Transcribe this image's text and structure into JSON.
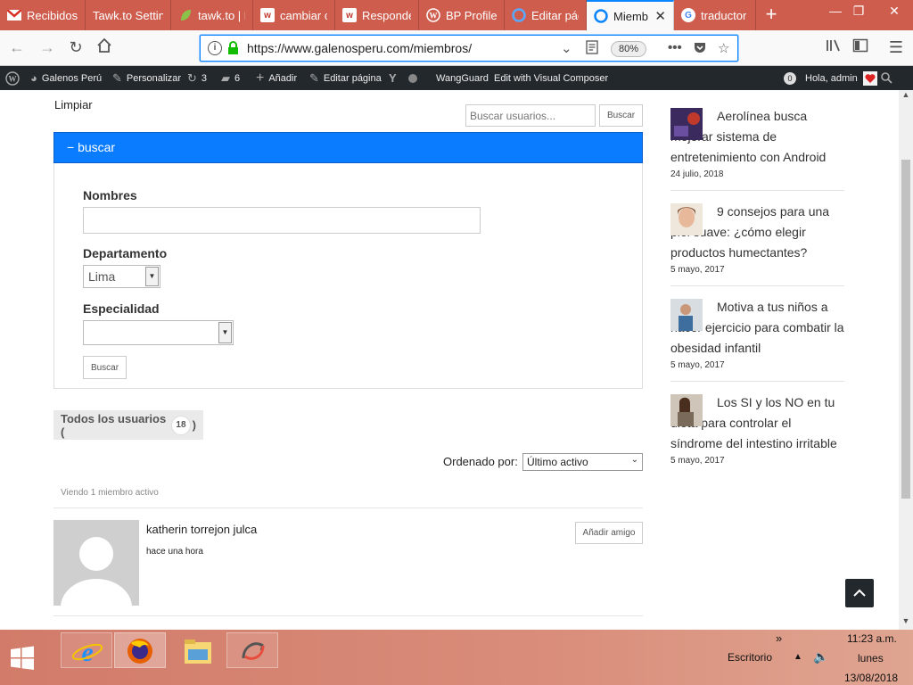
{
  "browser": {
    "tabs": [
      {
        "label": "Recibidos",
        "icon": "gmail-icon"
      },
      {
        "label": "Tawk.to Settin",
        "icon": "tawk-icon"
      },
      {
        "label": "tawk.to | F",
        "icon": "leaf-icon"
      },
      {
        "label": "cambiar c",
        "icon": "w-icon"
      },
      {
        "label": "Responde",
        "icon": "w-icon"
      },
      {
        "label": "BP Profile",
        "icon": "wordpress-icon"
      },
      {
        "label": "Editar pág",
        "icon": "wp-edit-icon"
      },
      {
        "label": "Miemb",
        "icon": "wp-edit-icon"
      },
      {
        "label": "traductor",
        "icon": "google-icon"
      }
    ],
    "url": "https://www.galenosperu.com/miembros/",
    "zoom": "80%"
  },
  "adminbar": {
    "site": "Galenos Perú",
    "customize": "Personalizar",
    "updates": "3",
    "comments": "6",
    "add": "Añadir",
    "edit_page": "Editar página",
    "wangguard": "WangGuard",
    "visual_composer": "Edit with Visual Composer",
    "notif_count": "0",
    "greeting": "Hola, admin"
  },
  "page": {
    "limpiar": "Limpiar",
    "search_placeholder": "Buscar usuarios...",
    "search_button": "Buscar",
    "panel_title": "− buscar",
    "form": {
      "nombres_label": "Nombres",
      "departamento_label": "Departamento",
      "departamento_value": "Lima",
      "especialidad_label": "Especialidad",
      "especialidad_value": "",
      "submit": "Buscar"
    },
    "all_users_prefix": "Todos los usuarios (",
    "all_users_count": "18",
    "all_users_suffix": ")",
    "order_label": "Ordenado por:",
    "order_value": "Último activo",
    "viewing": "Viendo 1 miembro activo",
    "member": {
      "name": "katherin torrejon julca",
      "last_active": "hace una hora",
      "add_friend": "Añadir amigo"
    }
  },
  "sidebar": {
    "posts": [
      {
        "title": "Aerolínea busca mejorar sistema de entretenimiento con Android",
        "date": "24 julio, 2018"
      },
      {
        "title": "9 consejos para una piel suave: ¿cómo elegir productos humectantes?",
        "date": "5 mayo, 2017"
      },
      {
        "title": "Motiva a tus niños a hacer ejercicio para combatir la obesidad infantil",
        "date": "5 mayo, 2017"
      },
      {
        "title": "Los SI y los NO en tu dieta para controlar el síndrome del intestino irritable",
        "date": "5 mayo, 2017"
      }
    ]
  },
  "taskbar": {
    "desktop": "Escritorio",
    "time": "11:23 a.m.",
    "day": "lunes",
    "date": "13/08/2018"
  },
  "colors": {
    "tabstrip": "#cf5d4d",
    "accent": "#0a84ff",
    "panel": "#0a7cff",
    "adminbar": "#23282d"
  }
}
